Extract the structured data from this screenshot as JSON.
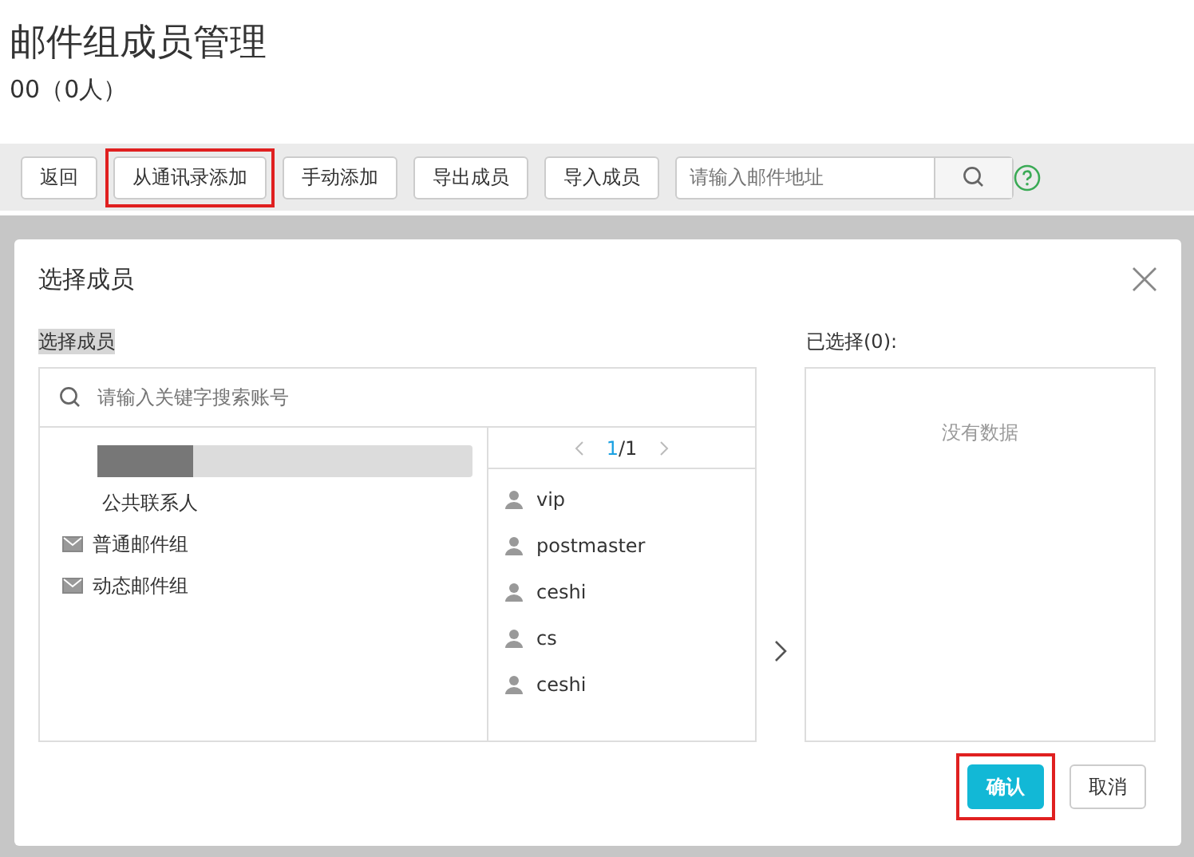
{
  "page": {
    "title": "邮件组成员管理",
    "subtitle": "00（0人）"
  },
  "toolbar": {
    "buttons": [
      {
        "label": "返回",
        "highlighted": false
      },
      {
        "label": "从通讯录添加",
        "highlighted": true
      },
      {
        "label": "手动添加",
        "highlighted": false
      },
      {
        "label": "导出成员",
        "highlighted": false
      },
      {
        "label": "导入成员",
        "highlighted": false
      }
    ],
    "search": {
      "placeholder": "请输入邮件地址"
    }
  },
  "dialog": {
    "title": "选择成员",
    "section_label": "选择成员",
    "selected_label": "已选择(0):",
    "search": {
      "placeholder": "请输入关键字搜索账号"
    },
    "tree": [
      {
        "kind": "redacted",
        "selected": true
      },
      {
        "kind": "plain",
        "label": "公共联系人",
        "selected": false
      },
      {
        "kind": "group",
        "label": "普通邮件组",
        "selected": false
      },
      {
        "kind": "group",
        "label": "动态邮件组",
        "selected": false
      }
    ],
    "pager": {
      "current": "1",
      "total": "/1"
    },
    "members": [
      {
        "name": "vip"
      },
      {
        "name": "postmaster"
      },
      {
        "name": "ceshi"
      },
      {
        "name": "cs"
      },
      {
        "name": "ceshi"
      }
    ],
    "empty_text": "没有数据",
    "buttons": [
      {
        "label": "确认",
        "kind": "primary",
        "highlighted": true
      },
      {
        "label": "取消",
        "kind": "default",
        "highlighted": false
      }
    ]
  }
}
